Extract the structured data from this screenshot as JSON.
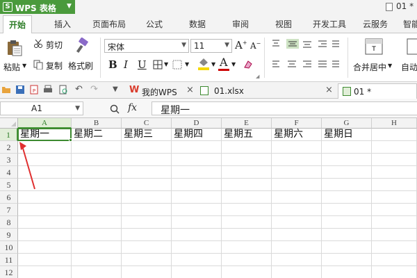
{
  "app": {
    "name": "WPS 表格",
    "logo_letter": "S",
    "open_doc": "01 *"
  },
  "ribbon_tabs": [
    "开始",
    "插入",
    "页面布局",
    "公式",
    "数据",
    "审阅",
    "视图",
    "开发工具",
    "云服务",
    "智能"
  ],
  "ribbon": {
    "paste": "粘贴",
    "cut": "剪切",
    "copy": "复制",
    "format_painter": "格式刷",
    "font_name": "宋体",
    "font_size": "11",
    "bold": "B",
    "italic": "I",
    "underline": "U",
    "merge_center": "合并居中",
    "auto_wrap": "自动",
    "font_color": "#cc0000",
    "highlight_color": "#f5d800"
  },
  "doc_tabs": {
    "tab1": "我的WPS",
    "tab2": "01.xlsx",
    "tab3": "01 *"
  },
  "formula_bar": {
    "name_box": "A1",
    "fx": "fx",
    "value": "星期一"
  },
  "grid": {
    "columns": [
      "A",
      "B",
      "C",
      "D",
      "E",
      "F",
      "G",
      "H"
    ],
    "rows": [
      "1",
      "2",
      "3",
      "4",
      "5",
      "6",
      "7",
      "8",
      "9",
      "10",
      "11",
      "12"
    ],
    "row1": [
      "星期一",
      "星期二",
      "星期三",
      "星期四",
      "星期五",
      "星期六",
      "星期日",
      ""
    ]
  },
  "accent": "#4a9a3c"
}
